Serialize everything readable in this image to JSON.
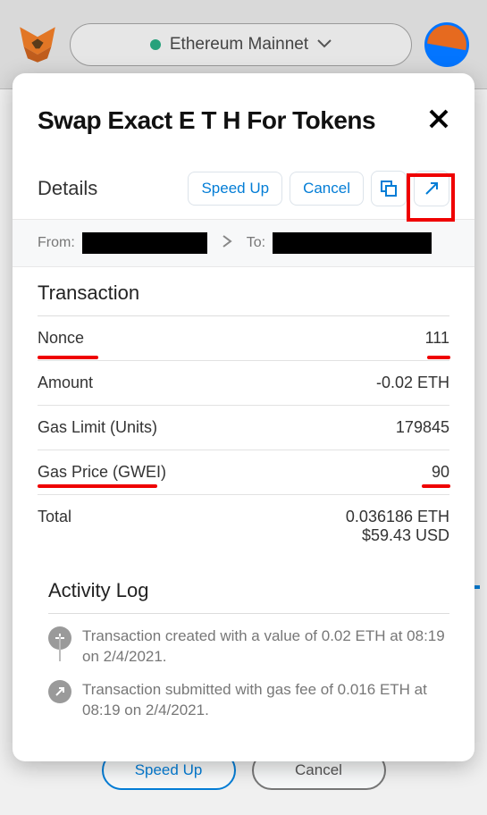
{
  "topbar": {
    "network": "Ethereum Mainnet"
  },
  "bgButtons": {
    "speedup": "Speed Up",
    "cancel": "Cancel"
  },
  "modal": {
    "title": "Swap Exact E T H For Tokens",
    "details_label": "Details",
    "speedup": "Speed Up",
    "cancel": "Cancel",
    "from_label": "From:",
    "to_label": "To:",
    "tx_title": "Transaction",
    "rows": {
      "nonce_label": "Nonce",
      "nonce_value": "111",
      "amount_label": "Amount",
      "amount_value": "-0.02 ETH",
      "gaslimit_label": "Gas Limit (Units)",
      "gaslimit_value": "179845",
      "gasprice_label": "Gas Price (GWEI)",
      "gasprice_value": "90",
      "total_label": "Total",
      "total_value": "0.036186 ETH",
      "total_usd": "$59.43 USD"
    },
    "activity": {
      "title": "Activity Log",
      "item1": "Transaction created with a value of 0.02 ETH at 08:19 on 2/4/2021.",
      "item2": "Transaction submitted with gas fee of 0.016 ETH at 08:19 on 2/4/2021."
    }
  }
}
